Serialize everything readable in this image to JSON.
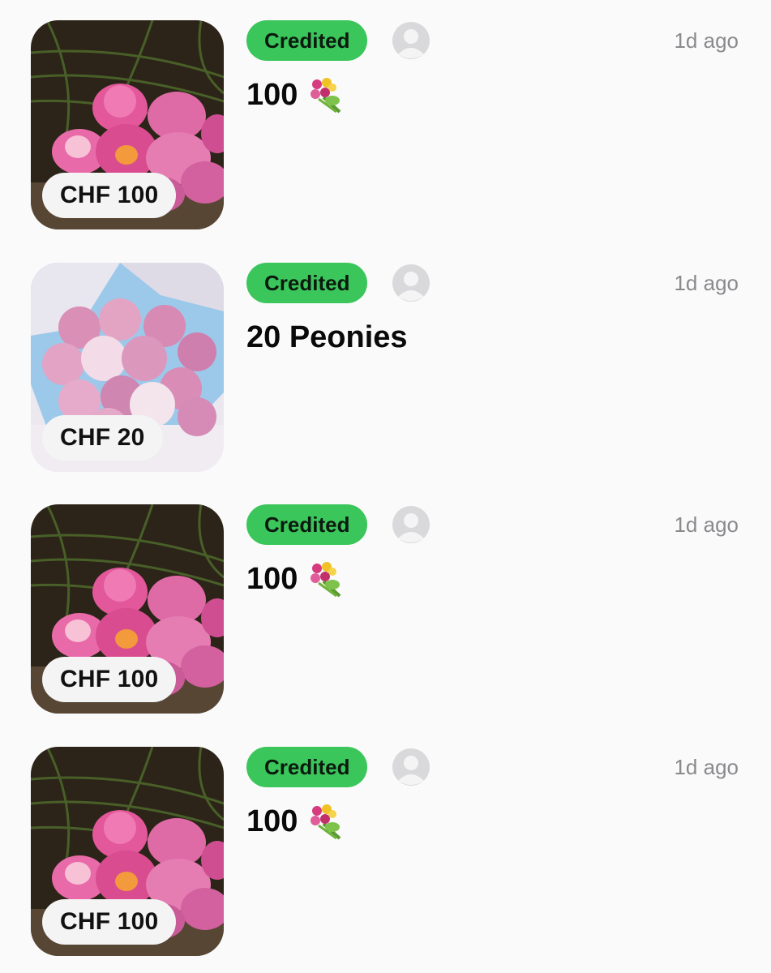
{
  "feed": {
    "items": [
      {
        "price": "CHF 100",
        "status": "Credited",
        "time": "1d ago",
        "title": "100",
        "title_icon": "bouquet-emoji",
        "image": "pink-lotus-bouquet",
        "status_color": "#3bc65b"
      },
      {
        "price": "CHF 20",
        "status": "Credited",
        "time": "1d ago",
        "title": "20 Peonies",
        "title_icon": "",
        "image": "pink-peony-bouquet",
        "status_color": "#3bc65b"
      },
      {
        "price": "CHF 100",
        "status": "Credited",
        "time": "1d ago",
        "title": "100",
        "title_icon": "bouquet-emoji",
        "image": "pink-lotus-bouquet",
        "status_color": "#3bc65b"
      },
      {
        "price": "CHF 100",
        "status": "Credited",
        "time": "1d ago",
        "title": "100",
        "title_icon": "bouquet-emoji",
        "image": "pink-lotus-bouquet",
        "status_color": "#3bc65b"
      }
    ]
  }
}
